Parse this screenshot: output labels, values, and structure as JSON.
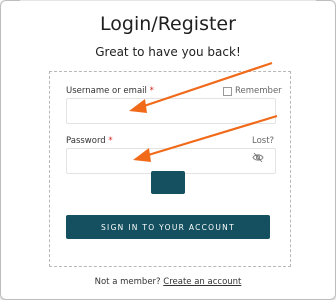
{
  "page": {
    "title": "Login/Register",
    "subtitle": "Great to have you back!"
  },
  "form": {
    "username_label": "Username or email",
    "username_required": "*",
    "username_value": "",
    "remember_label": "Remember",
    "remember_checked": false,
    "password_label": "Password",
    "password_required": "*",
    "password_value": "",
    "lost_link": "Lost?",
    "eye_icon": "eye-slash-icon",
    "captcha_button_label": "",
    "signin_label": "SIGN IN TO YOUR ACCOUNT"
  },
  "footer": {
    "prompt": "Not a member?",
    "link": "Create an account"
  },
  "colors": {
    "primary": "#14505f",
    "required": "#d9251d",
    "annotation_arrow": "#f06a1a"
  }
}
